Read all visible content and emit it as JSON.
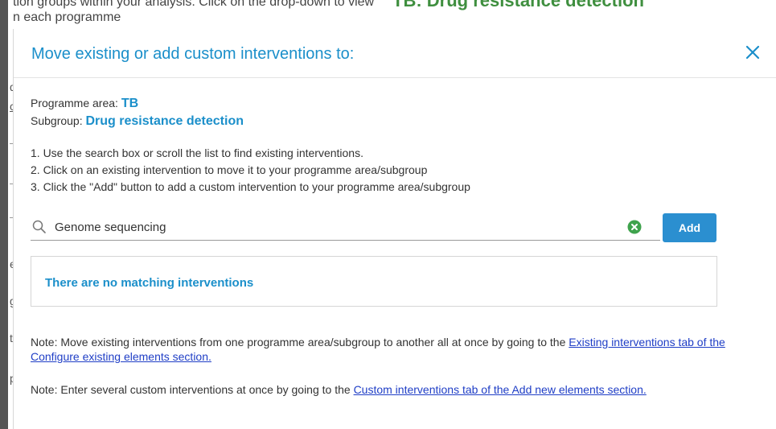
{
  "background": {
    "line1": "tion groups within your analysis. Click on the drop-down to view",
    "line2": "n each programme",
    "heading": "TB: Drug resistance detection",
    "gutter_chars": [
      "d",
      "c",
      "e",
      "g",
      "t",
      "p"
    ]
  },
  "modal": {
    "title": "Move existing or add custom interventions to:",
    "programme_area_label": "Programme area:",
    "programme_area_value": "TB",
    "subgroup_label": "Subgroup:",
    "subgroup_value": "Drug resistance detection",
    "steps": [
      "1. Use the search box or scroll the list to find existing interventions.",
      "2. Click on an existing intervention to move it to your programme area/subgroup",
      "3. Click the \"Add\" button to add a custom intervention to your programme area/subgroup"
    ],
    "search": {
      "value": "Genome sequencing",
      "placeholder": ""
    },
    "add_label": "Add",
    "no_results": "There are no matching interventions",
    "note1": {
      "text": "Note: Move existing interventions from one programme area/subgroup to another all at once by going to the ",
      "link": "Existing interventions tab of the Configure existing elements section."
    },
    "note2": {
      "text": "Note: Enter several custom interventions at once by going to the ",
      "link": "Custom interventions tab of the Add new elements section."
    }
  },
  "colors": {
    "accent": "#1b8fca",
    "button": "#2b8fd0",
    "clear_icon": "#3fa34d",
    "link": "#1f3ec6"
  },
  "icons": {
    "close": "close-icon",
    "search": "search-icon",
    "clear": "clear-search-icon"
  }
}
